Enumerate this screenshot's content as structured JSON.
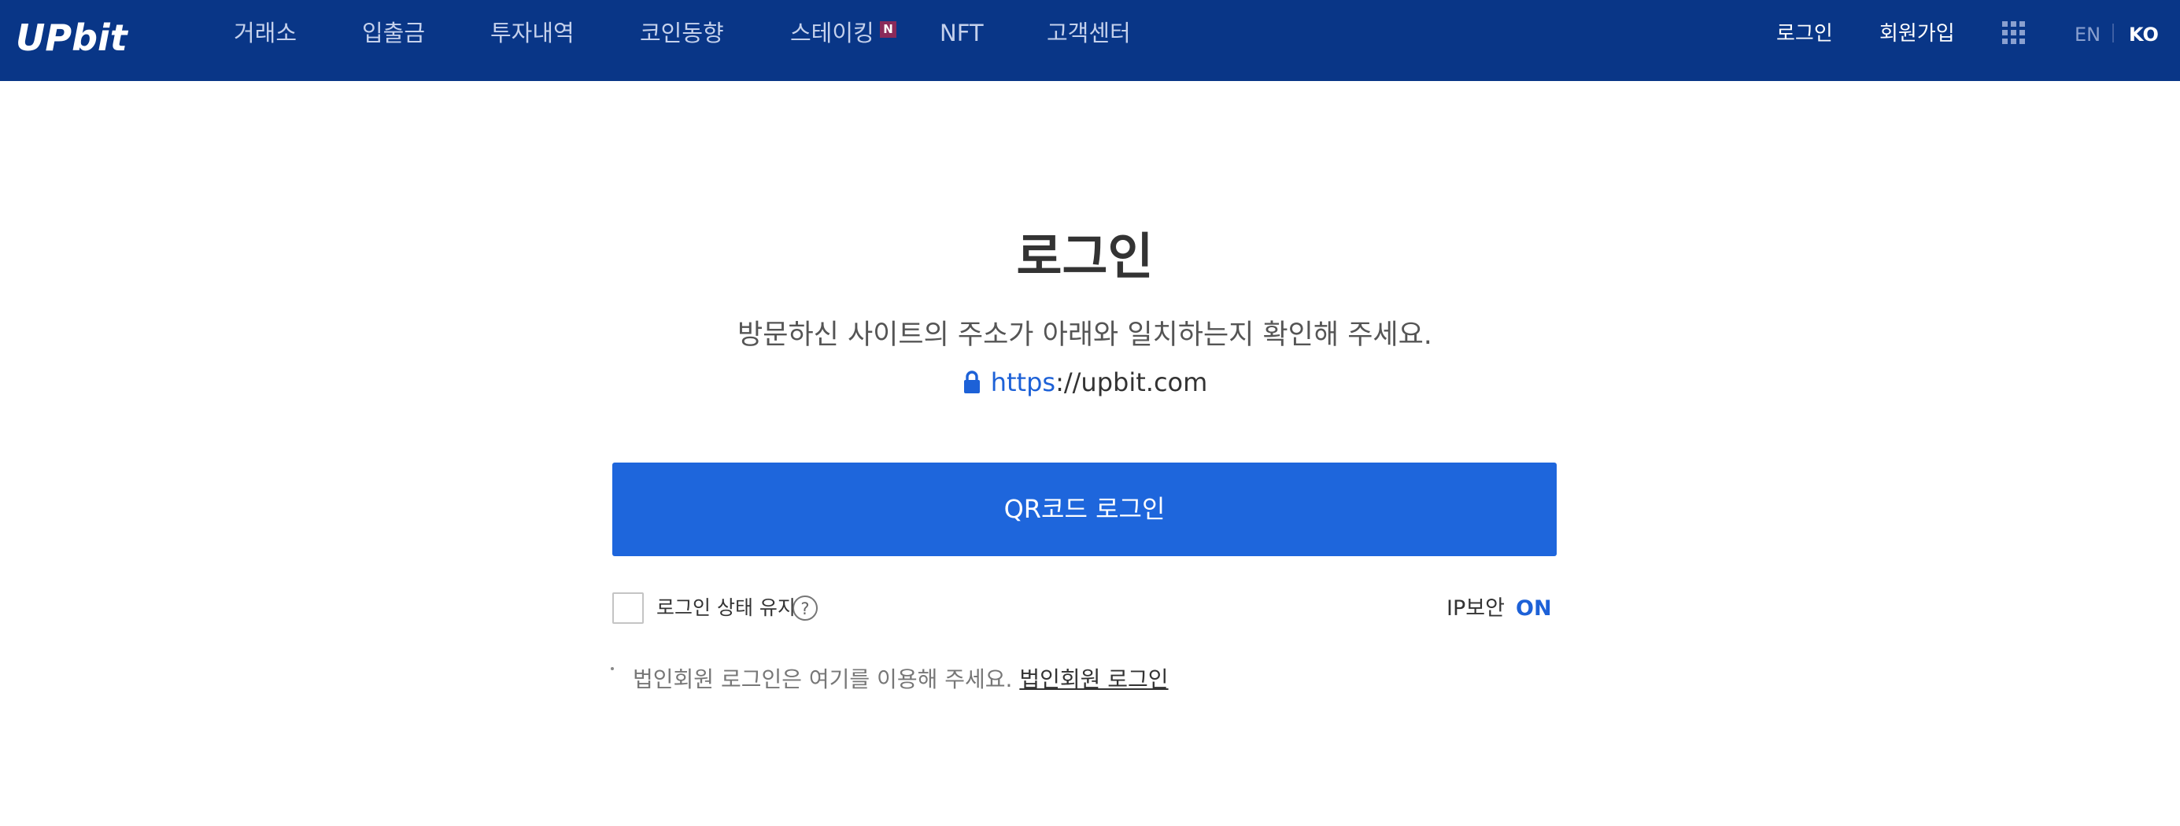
{
  "header": {
    "logo_text": "UPbit",
    "nav": [
      {
        "label": "거래소"
      },
      {
        "label": "입출금"
      },
      {
        "label": "투자내역"
      },
      {
        "label": "코인동향"
      },
      {
        "label": "스테이킹",
        "badge": "N"
      },
      {
        "label": "NFT"
      },
      {
        "label": "고객센터"
      }
    ],
    "login_label": "로그인",
    "signup_label": "회원가입",
    "apps_icon": "grid-icon",
    "lang_en": "EN",
    "lang_ko": "KO",
    "background_color": "#093687"
  },
  "main": {
    "title": "로그인",
    "notice": "방문하신 사이트의 주소가 아래와 일치하는지 확인해 주세요.",
    "url_scheme": "https",
    "url_rest": "://upbit.com",
    "lock_icon": "lock-icon",
    "qr_button_label": "QR코드 로그인",
    "accent_color": "#1e66dc",
    "keep_login_label": "로그인 상태 유지",
    "keep_login_checked": false,
    "help_icon": "question-circle-icon",
    "ip_security_label": "IP보안",
    "ip_security_value": "ON",
    "corp_notice": "법인회원 로그인은 여기를 이용해 주세요.",
    "corp_link": "법인회원 로그인"
  }
}
